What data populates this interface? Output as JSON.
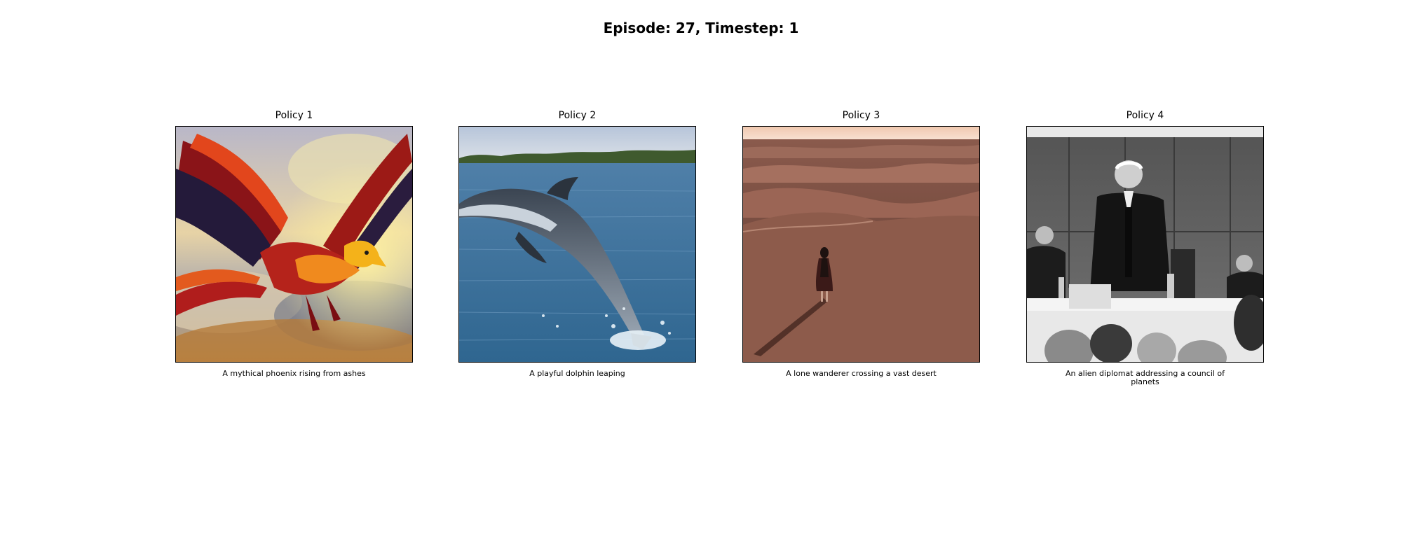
{
  "figure": {
    "title": "Episode: 27, Timestep: 1"
  },
  "panels": [
    {
      "title": "Policy 1",
      "caption": "A mythical phoenix rising from ashes",
      "image": "phoenix-image"
    },
    {
      "title": "Policy 2",
      "caption": "A playful dolphin leaping",
      "image": "dolphin-image"
    },
    {
      "title": "Policy 3",
      "caption": "A lone wanderer crossing a vast desert",
      "image": "desert-wanderer-image"
    },
    {
      "title": "Policy 4",
      "caption": "An alien diplomat addressing a council of planets",
      "image": "diplomat-council-image"
    }
  ]
}
